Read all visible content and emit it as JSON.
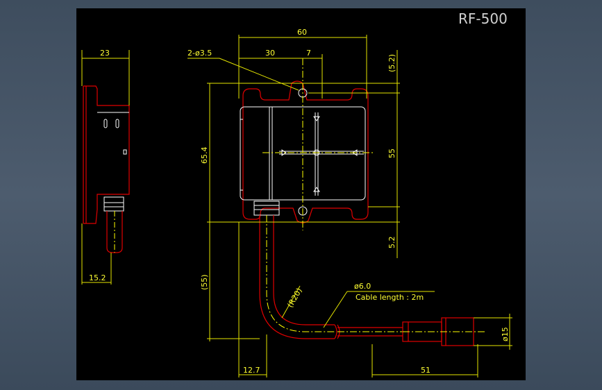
{
  "title": "RF-500",
  "labels": {
    "hole": "2-ø3.5",
    "cable_dia": "ø6.0",
    "cable_length": "Cable length : 2m",
    "bend_radius": "(R20)"
  },
  "dimensions": {
    "width": "60",
    "half_width": "30",
    "offset": "7",
    "top_margin": "(5.2)",
    "height": "65.4",
    "inner_height": "55",
    "bottom_margin": "5.2",
    "cable_run": "(55)",
    "cable_offset": "12.7",
    "connector_length": "51",
    "connector_dia": "ø15",
    "side_depth": "23",
    "side_body": "15.2"
  },
  "colors": {
    "background": "#000000",
    "outline": "#e00000",
    "dimension": "#e6e600",
    "detail": "#ffffff"
  }
}
